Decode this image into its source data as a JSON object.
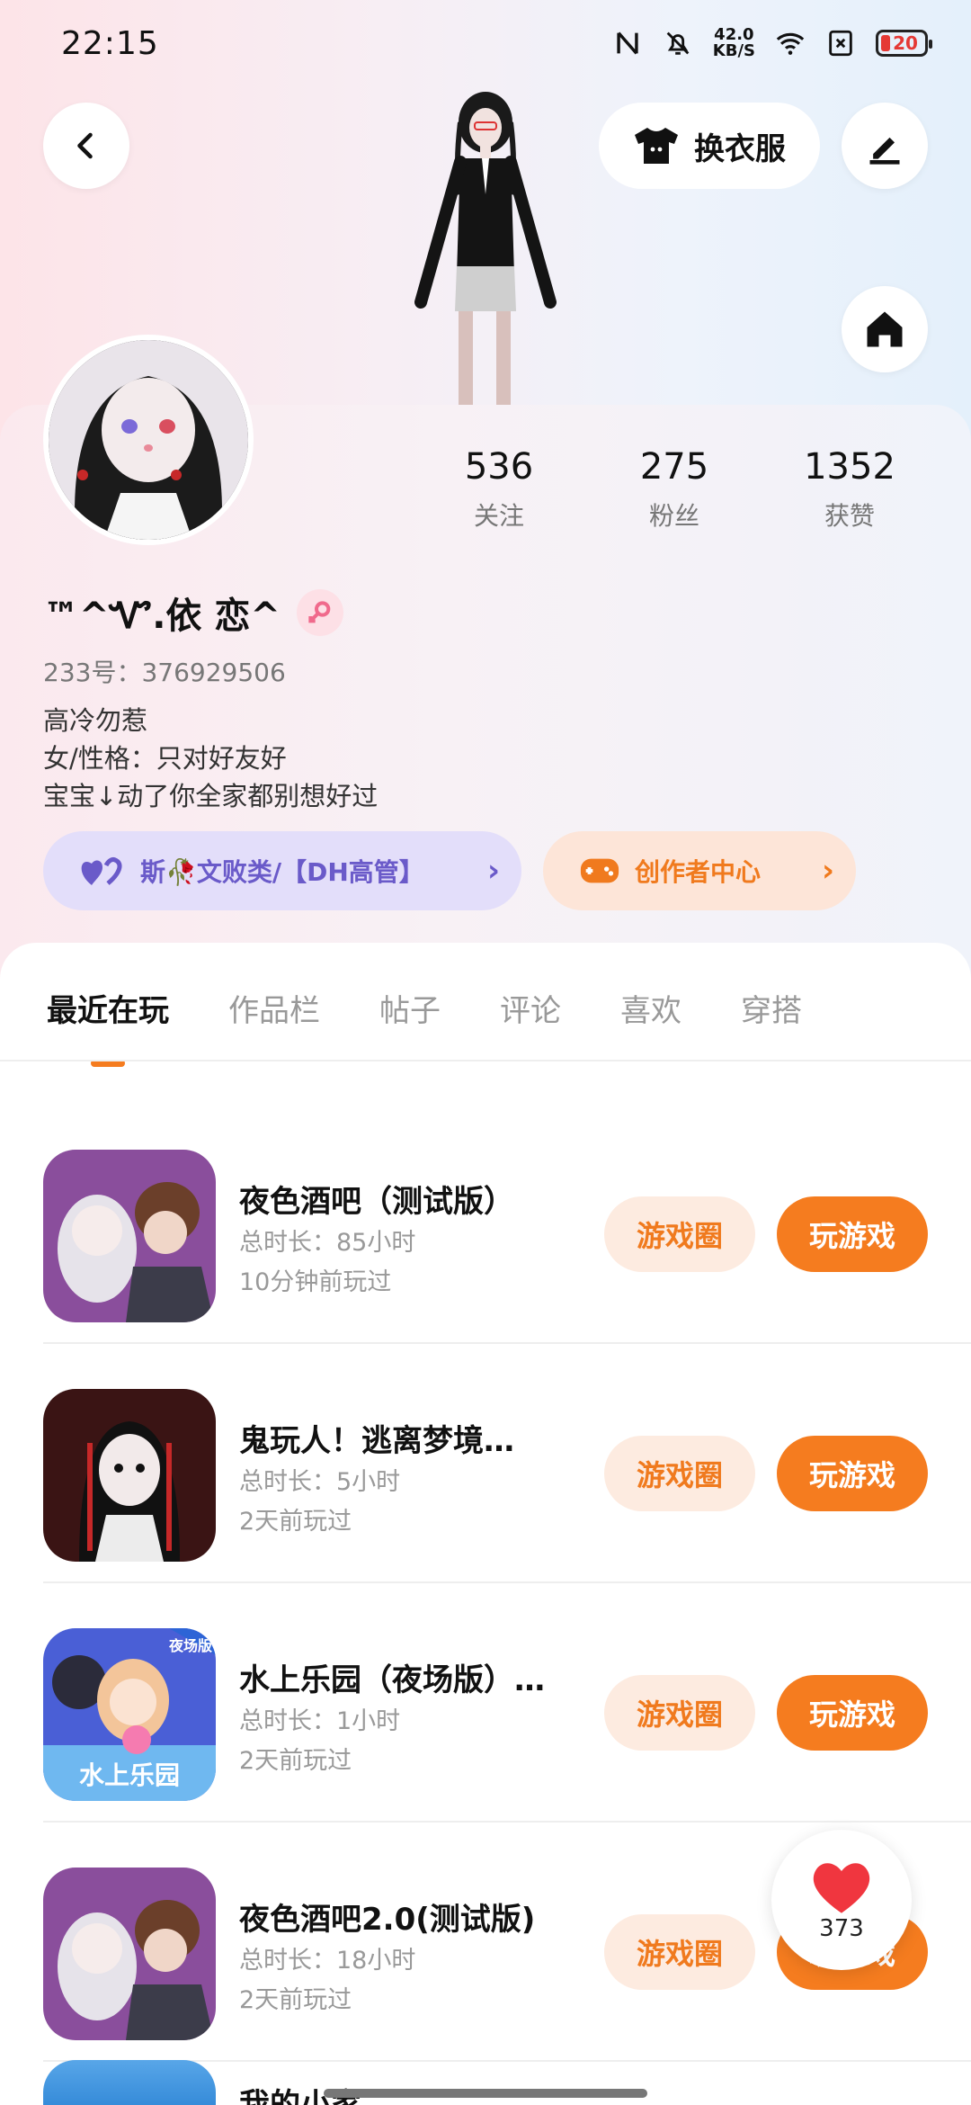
{
  "status_bar": {
    "time": "22:15",
    "net_speed_value": "42.0",
    "net_speed_unit": "KB/S",
    "battery": "20"
  },
  "header": {
    "dress_label": "换衣服"
  },
  "profile": {
    "stats": [
      {
        "value": "536",
        "label": "关注"
      },
      {
        "value": "275",
        "label": "粉丝"
      },
      {
        "value": "1352",
        "label": "获赞"
      }
    ],
    "nickname": "™^Ꮙ.依  恋^",
    "uid": "233号：376929506",
    "bio": [
      "高冷勿惹",
      "女/性格：只对好友好",
      "宝宝↓动了你全家都别想好过"
    ],
    "guild_label": "斯🥀文败类/【DH高管】",
    "creator_label": "创作者中心"
  },
  "tabs": [
    "最近在玩",
    "作品栏",
    "帖子",
    "评论",
    "喜欢",
    "穿搭"
  ],
  "games": [
    {
      "title": "夜色酒吧（测试版）",
      "duration": "总时长：85小时",
      "last_played": "10分钟前玩过",
      "circle_label": "游戏圈",
      "play_label": "玩游戏"
    },
    {
      "title": "鬼玩人！逃离梦境…",
      "duration": "总时长：5小时",
      "last_played": "2天前玩过",
      "circle_label": "游戏圈",
      "play_label": "玩游戏"
    },
    {
      "title": "水上乐园（夜场版）…",
      "duration": "总时长：1小时",
      "last_played": "2天前玩过",
      "circle_label": "游戏圈",
      "play_label": "玩游戏",
      "icon_badge": "夜场版",
      "icon_text": "水上乐园"
    },
    {
      "title": "夜色酒吧2.0(测试版)",
      "duration": "总时长：18小时",
      "last_played": "2天前玩过",
      "circle_label": "游戏圈",
      "play_label": "玩游戏"
    }
  ],
  "partial_game_title": "我的小家",
  "like_float": {
    "count": "373"
  },
  "colors": {
    "accent": "#f57c1f",
    "guild": "#6a5ac9",
    "like": "#f0363f"
  }
}
